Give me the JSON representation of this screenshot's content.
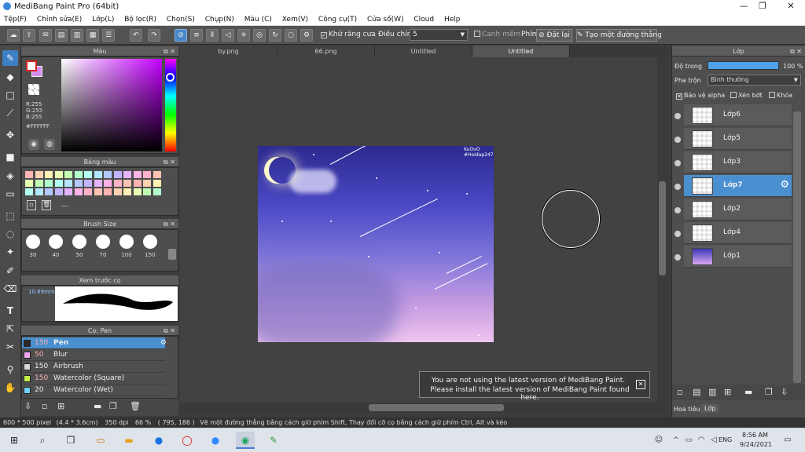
{
  "window": {
    "title": "MediBang Paint Pro (64bit)",
    "minimize": "—",
    "maximize": "❐",
    "close": "✕"
  },
  "menu": [
    "Tệp(F)",
    "Chỉnh sửa(E)",
    "Lớp(L)",
    "Bộ lọc(R)",
    "Chọn(S)",
    "Chụp(N)",
    "Màu (C)",
    "Xem(V)",
    "Công cụ(T)",
    "Cửa số(W)",
    "Cloud",
    "Help"
  ],
  "toolbar": {
    "antialias_label": "Khử răng cưa",
    "adjust_label": "Điều chỉnh",
    "adjust_value": "5",
    "ruler_label": "Canh mềm",
    "pen_label": "Phím",
    "reset_label": "Đặt lại",
    "straight_label": "Tạo một đường thẳng"
  },
  "color_panel": {
    "title": "Màu",
    "r": "R:255",
    "g": "G:255",
    "b": "B:255",
    "hex": "#FFFFFF"
  },
  "palette_panel": {
    "title": "Bảng màu",
    "value": "---"
  },
  "brush_size_panel": {
    "title": "Brush Size",
    "sizes": [
      "30",
      "40",
      "50",
      "70",
      "100",
      "150"
    ]
  },
  "preview_panel": {
    "title": "Xem trước cọ",
    "size": "10.89mm"
  },
  "brush_panel": {
    "title": "Cọ: Pen",
    "brushes": [
      {
        "size": "150",
        "name": "Pen",
        "color": "#2b2b2b"
      },
      {
        "size": "50",
        "name": "Blur",
        "color": "#f0a8f0"
      },
      {
        "size": "150",
        "name": "Airbrush",
        "color": "#d8d8d8"
      },
      {
        "size": "150",
        "name": "Watercolor (Square)",
        "color": "#c6f04a"
      },
      {
        "size": "20",
        "name": "Watercolor (Wet)",
        "color": "#6fd0ff"
      }
    ]
  },
  "tabs": [
    "by.png",
    "66.png",
    "Untitled",
    "Untitled"
  ],
  "artwork": {
    "watermark_line1": "KuOvO",
    "watermark_line2": "#Hoidap247"
  },
  "popup": {
    "line1": "You are not using the latest version of MediBang Paint.",
    "line2": "Please install the latest version of MediBang Paint found here.",
    "close": "✕"
  },
  "layer_panel": {
    "title": "Lớp",
    "opacity_label": "Độ trong",
    "opacity_value": "100 %",
    "blend_label": "Pha trộn",
    "blend_value": "Bình thường",
    "protect_alpha": "Bảo vệ alpha",
    "clipping": "Xén bớt",
    "lock": "Khóa",
    "layers": [
      "Lớp6",
      "Lớp5",
      "Lớp3",
      "Lớp7",
      "Lớp2",
      "Lớp4",
      "Lớp1"
    ],
    "bottom_tabs": [
      "Hoa tiêu",
      "Lớp"
    ]
  },
  "status": {
    "dims": "600 * 500 pixel",
    "physical": "(4.4 * 3.6cm)",
    "dpi": "350 dpi",
    "zoom": "66 %",
    "coords": "( 795, 186 )",
    "hint": "Vẽ một đường thẳng bằng cách giữ phím Shift, Thay đổi cỡ cọ bằng cách giữ phím Ctrl, Alt và kéo"
  },
  "taskbar": {
    "lang": "ENG",
    "time": "8:56 AM",
    "date": "9/24/2021"
  }
}
